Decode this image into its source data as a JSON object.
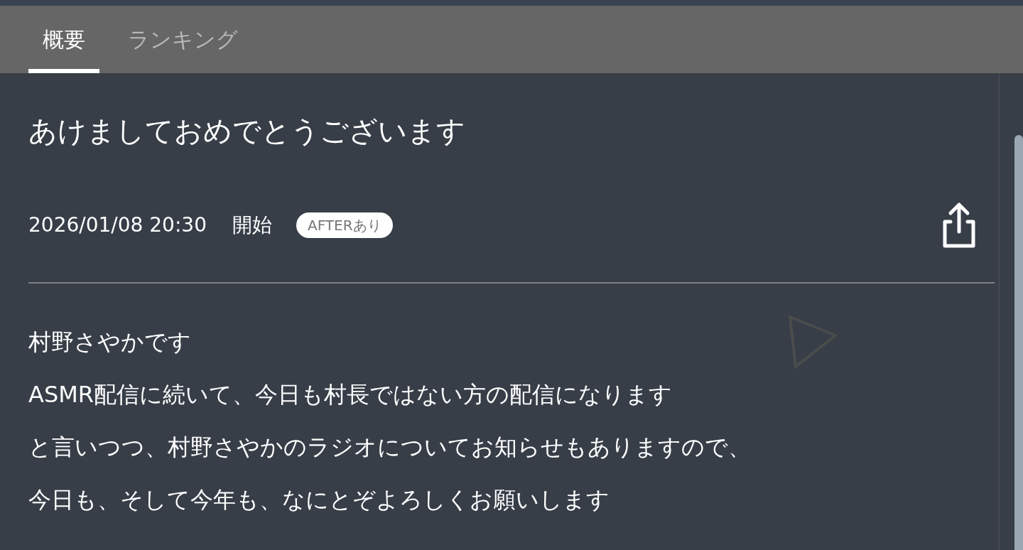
{
  "tabs": [
    {
      "label": "概要",
      "selected": true
    },
    {
      "label": "ランキング",
      "selected": false
    }
  ],
  "title": "あけましておめでとうございます",
  "schedule": {
    "datetime": "2026/01/08 20:30",
    "status": "開始",
    "badge": "AFTERあり"
  },
  "description": [
    "村野さやかです",
    "ASMR配信に続いて、今日も村長ではない方の配信になります",
    "と言いつつ、村野さやかのラジオについてお知らせもありますので、",
    "今日も、そして今年も、なにとぞよろしくお願いします"
  ]
}
